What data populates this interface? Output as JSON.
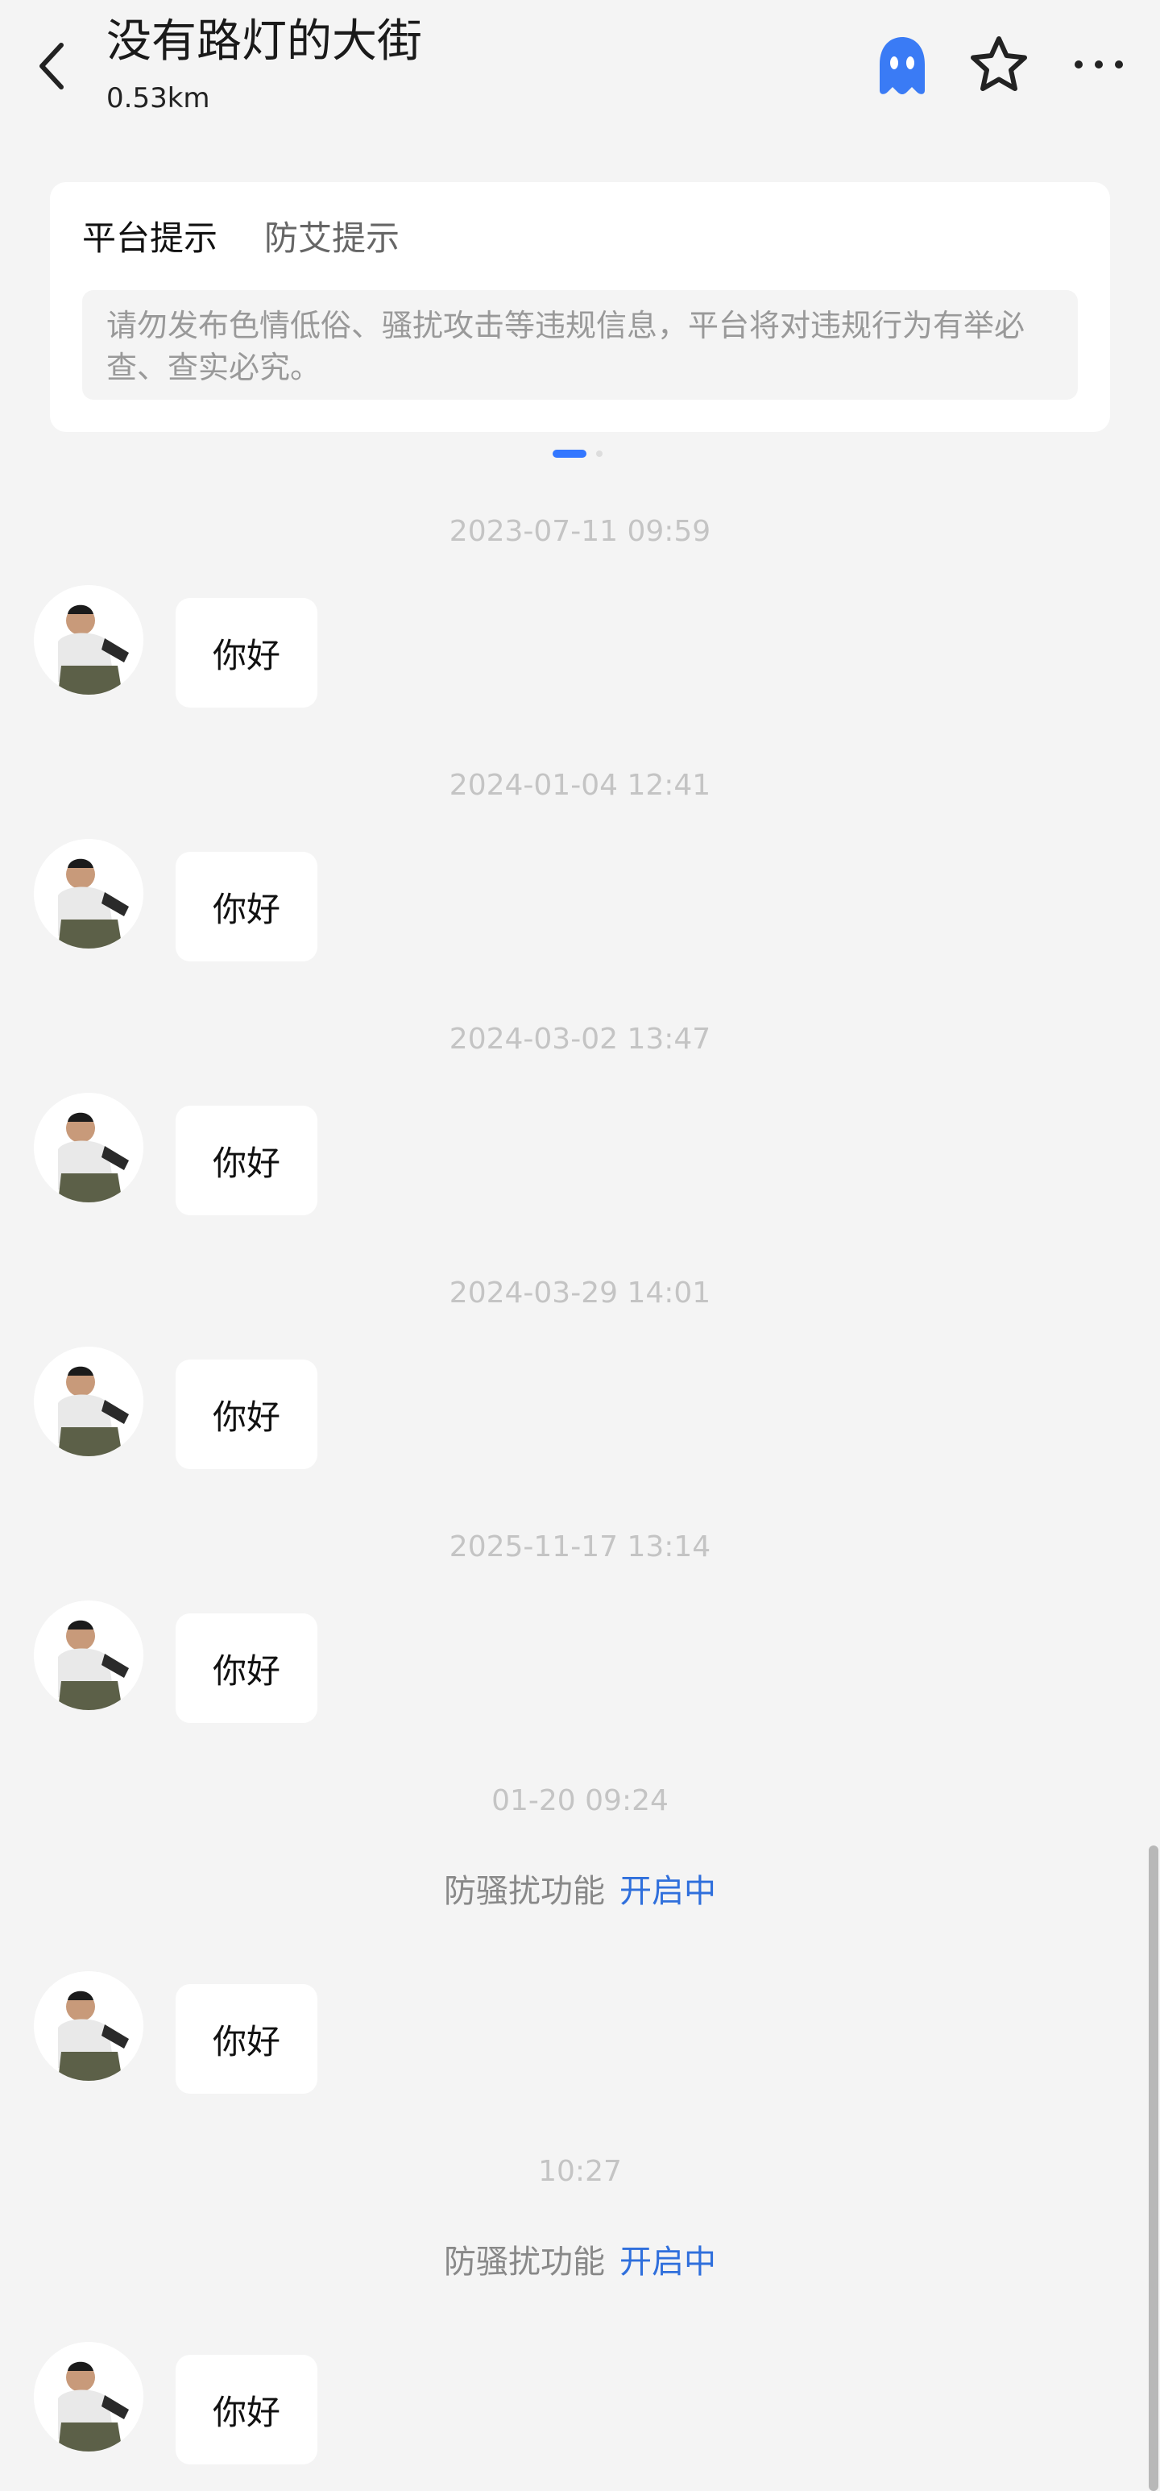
{
  "header": {
    "title": "没有路灯的大街",
    "distance": "0.53km",
    "icons": [
      "back-arrow-icon",
      "ghost-icon",
      "star-icon",
      "more-dots-icon"
    ],
    "accent_color": "#3a7bf5"
  },
  "tip_card": {
    "tabs": [
      {
        "label": "平台提示"
      },
      {
        "label": "防艾提示"
      }
    ],
    "selected_tab": "平台提示",
    "text": "请勿发布色情低俗、骚扰攻击等违规信息，平台将对违规行为有举必查、查实必究。",
    "page_indicator": {
      "current": 1,
      "total": 2
    }
  },
  "messages": [
    {
      "timestamp": "2023-07-11 09:59",
      "text": "你好"
    },
    {
      "timestamp": "2024-01-04 12:41",
      "text": "你好"
    },
    {
      "timestamp": "2024-03-02 13:47",
      "text": "你好"
    },
    {
      "timestamp": "2024-03-29 14:01",
      "text": "你好"
    },
    {
      "timestamp": "2025-11-17 13:14",
      "text": "你好"
    },
    {
      "timestamp": "01-20 09:24",
      "notice": {
        "label": "防骚扰功能",
        "status": "开启中"
      },
      "text": "你好"
    },
    {
      "timestamp": "10:27",
      "notice": {
        "label": "防骚扰功能",
        "status": "开启中"
      },
      "text": "你好"
    }
  ]
}
